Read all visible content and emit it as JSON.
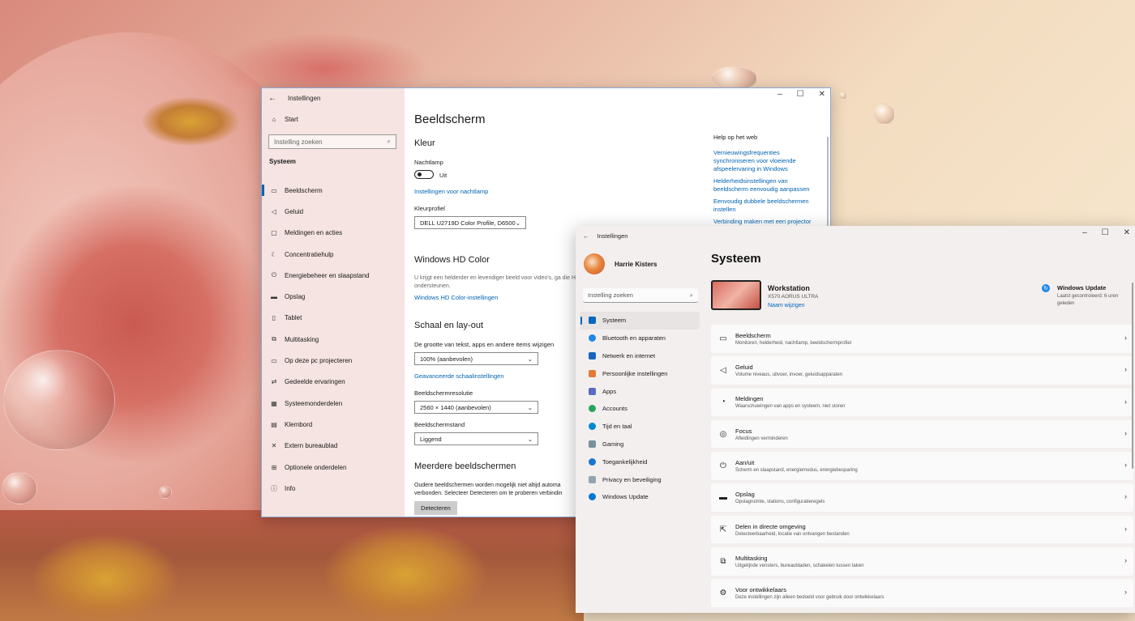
{
  "win10": {
    "title": "Instellingen",
    "start": "Start",
    "search_placeholder": "Instelling zoeken",
    "section": "Systeem",
    "nav": [
      {
        "label": "Beeldscherm",
        "icon": "monitor-icon"
      },
      {
        "label": "Geluid",
        "icon": "speaker-icon"
      },
      {
        "label": "Meldingen en acties",
        "icon": "notification-icon"
      },
      {
        "label": "Concentratiehulp",
        "icon": "moon-icon"
      },
      {
        "label": "Energiebeheer en slaapstand",
        "icon": "power-icon"
      },
      {
        "label": "Opslag",
        "icon": "storage-icon"
      },
      {
        "label": "Tablet",
        "icon": "tablet-icon"
      },
      {
        "label": "Multitasking",
        "icon": "multitasking-icon"
      },
      {
        "label": "Op deze pc projecteren",
        "icon": "project-icon"
      },
      {
        "label": "Gedeelde ervaringen",
        "icon": "share-icon"
      },
      {
        "label": "Systeemonderdelen",
        "icon": "components-icon"
      },
      {
        "label": "Klembord",
        "icon": "clipboard-icon"
      },
      {
        "label": "Extern bureaublad",
        "icon": "remote-icon"
      },
      {
        "label": "Optionele onderdelen",
        "icon": "grid-icon"
      },
      {
        "label": "Info",
        "icon": "info-icon"
      }
    ],
    "page_title": "Beeldscherm",
    "color_heading": "Kleur",
    "nightlight_label": "Nachtlamp",
    "nightlight_state": "Uit",
    "nightlight_settings_link": "Instellingen voor nachtlamp",
    "colorprofile_label": "Kleurprofiel",
    "colorprofile_value": "DELL U2719D Color Profile, D6500",
    "hdr_heading": "Windows HD Color",
    "hdr_desc": "U krijgt een helderder en levendiger beeld voor video's, ga die HDR ondersteunen.",
    "hdr_link": "Windows HD Color-instellingen",
    "scale_heading": "Schaal en lay-out",
    "scale_label": "De grootte van tekst, apps en andere items wijzigen",
    "scale_value": "100% (aanbevolen)",
    "scale_advanced_link": "Geavanceerde schaalinstellingen",
    "resolution_label": "Beeldschermresolutie",
    "resolution_value": "2560 × 1440 (aanbevolen)",
    "orientation_label": "Beeldschermstand",
    "orientation_value": "Liggend",
    "multi_heading": "Meerdere beeldschermen",
    "multi_desc": "Oudere beeldschermen worden mogelijk niet altijd automa verbonden. Selecteer Detecteren om te proberen verbindin",
    "detect_button": "Detecteren",
    "help_title": "Help op het web",
    "help_links": [
      "Vernieuwingsfrequenties synchroniseren voor vloeiende afspeelervaring in Windows",
      "Helderheidsinstellingen van beeldscherm eenvoudig aanpassen",
      "Eenvoudig dubbele beeldschermen instellen",
      "Verbinding maken met een projector"
    ]
  },
  "win11": {
    "title": "Instellingen",
    "username": "Harrie Kisters",
    "search_placeholder": "Instelling zoeken",
    "nav": [
      {
        "label": "Systeem",
        "icon": "system-icon",
        "color": "#0067c0"
      },
      {
        "label": "Bluetooth en apparaten",
        "icon": "bluetooth-icon",
        "color": "#1e88e5"
      },
      {
        "label": "Netwerk en internet",
        "icon": "wifi-icon",
        "color": "#1565c0"
      },
      {
        "label": "Persoonlijke instellingen",
        "icon": "brush-icon",
        "color": "#e07b39"
      },
      {
        "label": "Apps",
        "icon": "apps-icon",
        "color": "#5c6bc0"
      },
      {
        "label": "Accounts",
        "icon": "account-icon",
        "color": "#26a65b"
      },
      {
        "label": "Tijd en taal",
        "icon": "globe-icon",
        "color": "#0288d1"
      },
      {
        "label": "Gaming",
        "icon": "gamepad-icon",
        "color": "#78909c"
      },
      {
        "label": "Toegankelijkheid",
        "icon": "accessibility-icon",
        "color": "#1976d2"
      },
      {
        "label": "Privacy en beveiliging",
        "icon": "shield-icon",
        "color": "#90a4ae"
      },
      {
        "label": "Windows Update",
        "icon": "update-icon",
        "color": "#0078d4"
      }
    ],
    "page_title": "Systeem",
    "device_name": "Workstation",
    "device_model": "X570 AORUS ULTRA",
    "rename_link": "Naam wijzigen",
    "wu_title": "Windows Update",
    "wu_sub": "Laatst gecontroleerd: 6 uren geleden",
    "cards": [
      {
        "title": "Beeldscherm",
        "desc": "Monitoren, helderheid, nachtlamp, beeldschermprofiel",
        "icon": "monitor-icon"
      },
      {
        "title": "Geluid",
        "desc": "Volume niveaus, uitvoer, invoer, geluidsapparaten",
        "icon": "speaker-icon"
      },
      {
        "title": "Meldingen",
        "desc": "Waarschuwingen van apps en systeem, niet storen",
        "icon": "bell-icon"
      },
      {
        "title": "Focus",
        "desc": "Afleidingen verminderen",
        "icon": "focus-icon"
      },
      {
        "title": "Aan/uit",
        "desc": "Scherm en slaapstand, energiemodus, energiebesparing",
        "icon": "power-icon"
      },
      {
        "title": "Opslag",
        "desc": "Opslagruimte, stations, configuratieregels",
        "icon": "storage-icon"
      },
      {
        "title": "Delen in directe omgeving",
        "desc": "Detecteerbaarheid, locatie van ontvangen bestanden",
        "icon": "share-icon"
      },
      {
        "title": "Multitasking",
        "desc": "Uitgelijnde vensters, bureaubladen, schakelen tussen taken",
        "icon": "multitasking-icon"
      },
      {
        "title": "Voor ontwikkelaars",
        "desc": "Deze instellingen zijn alleen bedoeld voor gebruik door ontwikkelaars",
        "icon": "developer-icon"
      }
    ]
  }
}
